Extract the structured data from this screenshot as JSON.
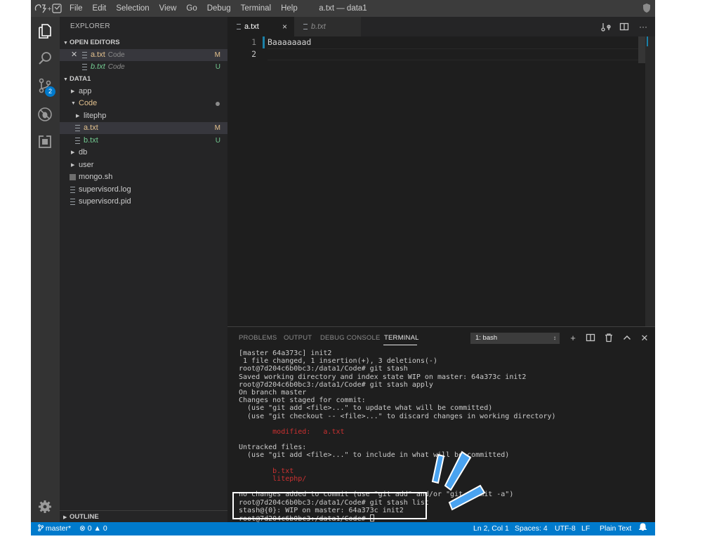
{
  "window": {
    "title": "a.txt — data1",
    "menu": [
      "File",
      "Edit",
      "Selection",
      "View",
      "Go",
      "Debug",
      "Terminal",
      "Help"
    ]
  },
  "activity": {
    "scm_badge": "2"
  },
  "sidebar": {
    "title": "EXPLORER",
    "open_editors": {
      "header": "OPEN EDITORS",
      "items": [
        {
          "name": "a.txt",
          "desc": "Code",
          "status": "M"
        },
        {
          "name": "b.txt",
          "desc": "Code",
          "status": "U"
        }
      ]
    },
    "folder": {
      "header": "DATA1",
      "items": [
        {
          "name": "app"
        },
        {
          "name": "Code"
        },
        {
          "name": "litephp"
        },
        {
          "name": "a.txt",
          "status": "M"
        },
        {
          "name": "b.txt",
          "status": "U"
        },
        {
          "name": "db"
        },
        {
          "name": "user"
        },
        {
          "name": "mongo.sh"
        },
        {
          "name": "supervisord.log"
        },
        {
          "name": "supervisord.pid"
        }
      ]
    },
    "outline": "OUTLINE"
  },
  "editor": {
    "tabs": [
      {
        "label": "a.txt",
        "close": "×"
      },
      {
        "label": "b.txt"
      }
    ],
    "line_numbers": [
      "1",
      "2"
    ],
    "lines": [
      "Baaaaaaad",
      ""
    ]
  },
  "panel": {
    "tabs": [
      "PROBLEMS",
      "OUTPUT",
      "DEBUG CONSOLE",
      "TERMINAL"
    ],
    "terminal_select": "1: bash",
    "lines": [
      "[master 64a373c] init2",
      " 1 file changed, 1 insertion(+), 3 deletions(-)",
      "root@7d204c6b0bc3:/data1/Code# git stash",
      "Saved working directory and index state WIP on master: 64a373c init2",
      "root@7d204c6b0bc3:/data1/Code# git stash apply",
      "On branch master",
      "Changes not staged for commit:",
      "  (use \"git add <file>...\" to update what will be committed)",
      "  (use \"git checkout -- <file>...\" to discard changes in working directory)",
      "",
      "        modified:   a.txt",
      "",
      "Untracked files:",
      "  (use \"git add <file>...\" to include in what will be committed)",
      "",
      "        b.txt",
      "        litephp/",
      "",
      "no changes added to commit (use \"git add\" and/or \"git commit -a\")",
      "root@7d204c6b0bc3:/data1/Code# git stash list",
      "stash@{0}: WIP on master: 64a373c init2",
      "root@7d204c6b0bc3:/data1/Code# "
    ],
    "red_lines": [
      10,
      15,
      16
    ]
  },
  "status": {
    "branch": "master*",
    "errors": "0",
    "warnings": "0",
    "position": "Ln 2, Col 1",
    "spaces": "Spaces: 4",
    "encoding": "UTF-8",
    "eol": "LF",
    "language": "Plain Text"
  },
  "colors": {
    "statusbar": "#007acc",
    "modified": "#e2c08d",
    "untracked": "#73c991",
    "terminal_red": "#cd3131",
    "annotation_blue": "#4aa3f0"
  }
}
